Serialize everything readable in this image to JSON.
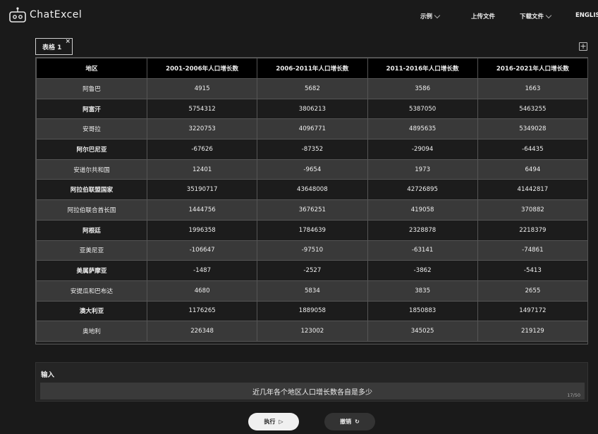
{
  "header": {
    "logo_text": "ChatExcel",
    "nav": [
      {
        "label": "示例",
        "dropdown": true
      },
      {
        "label": "上传文件",
        "dropdown": false
      },
      {
        "label": "下载文件",
        "dropdown": true
      },
      {
        "label": "ENGLISH",
        "dropdown": false
      }
    ]
  },
  "sheet_tabs": [
    {
      "label": "表格 1",
      "close": "×"
    }
  ],
  "add_sheet_icon": "plus-square-icon",
  "table": {
    "columns": [
      "地区",
      "2001-2006年人口增长数",
      "2006-2011年人口增长数",
      "2011-2016年人口增长数",
      "2016-2021年人口增长数"
    ],
    "rows": [
      [
        "阿鲁巴",
        "4915",
        "5682",
        "3586",
        "1663"
      ],
      [
        "阿富汗",
        "5754312",
        "3806213",
        "5387050",
        "5463255"
      ],
      [
        "安哥拉",
        "3220753",
        "4096771",
        "4895635",
        "5349028"
      ],
      [
        "阿尔巴尼亚",
        "-67626",
        "-87352",
        "-29094",
        "-64435"
      ],
      [
        "安道尔共和国",
        "12401",
        "-9654",
        "1973",
        "6494"
      ],
      [
        "阿拉伯联盟国家",
        "35190717",
        "43648008",
        "42726895",
        "41442817"
      ],
      [
        "阿拉伯联合酋长国",
        "1444756",
        "3676251",
        "419058",
        "370882"
      ],
      [
        "阿根廷",
        "1996358",
        "1784639",
        "2328878",
        "2218379"
      ],
      [
        "亚美尼亚",
        "-106647",
        "-97510",
        "-63141",
        "-74861"
      ],
      [
        "美属萨摩亚",
        "-1487",
        "-2527",
        "-3862",
        "-5413"
      ],
      [
        "安提瓜和巴布达",
        "4680",
        "5834",
        "3835",
        "2655"
      ],
      [
        "澳大利亚",
        "1176265",
        "1889058",
        "1850883",
        "1497172"
      ],
      [
        "奥地利",
        "226348",
        "123002",
        "345025",
        "219129"
      ]
    ]
  },
  "input": {
    "label": "输入",
    "value": "近几年各个地区人口增长数各自是多少",
    "counter": "17/50"
  },
  "buttons": {
    "run_label": "执行",
    "run_icon": "play-icon",
    "undo_label": "撤销",
    "undo_icon": "undo-icon"
  },
  "colors": {
    "background": "#1a1a1a",
    "header_row": "#000000",
    "row_light": "#393939",
    "row_dark": "#1c1c1c"
  }
}
